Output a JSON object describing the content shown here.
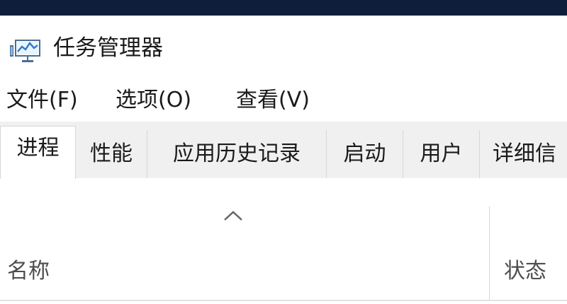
{
  "window": {
    "title": "任务管理器",
    "icon": "task-manager-icon"
  },
  "menu": {
    "items": [
      "文件(F)",
      "选项(O)",
      "查看(V)"
    ]
  },
  "tabs": {
    "items": [
      "进程",
      "性能",
      "应用历史记录",
      "启动",
      "用户",
      "详细信"
    ],
    "active": "进程"
  },
  "table": {
    "sort_icon": "sort-ascending-icon",
    "columns": [
      "名称",
      "状态"
    ]
  },
  "colors": {
    "title_strip": "#0f1e3a",
    "tab_background": "#f0f0f0",
    "active_tab": "#ffffff",
    "column_header_text": "#4d4d4d"
  }
}
